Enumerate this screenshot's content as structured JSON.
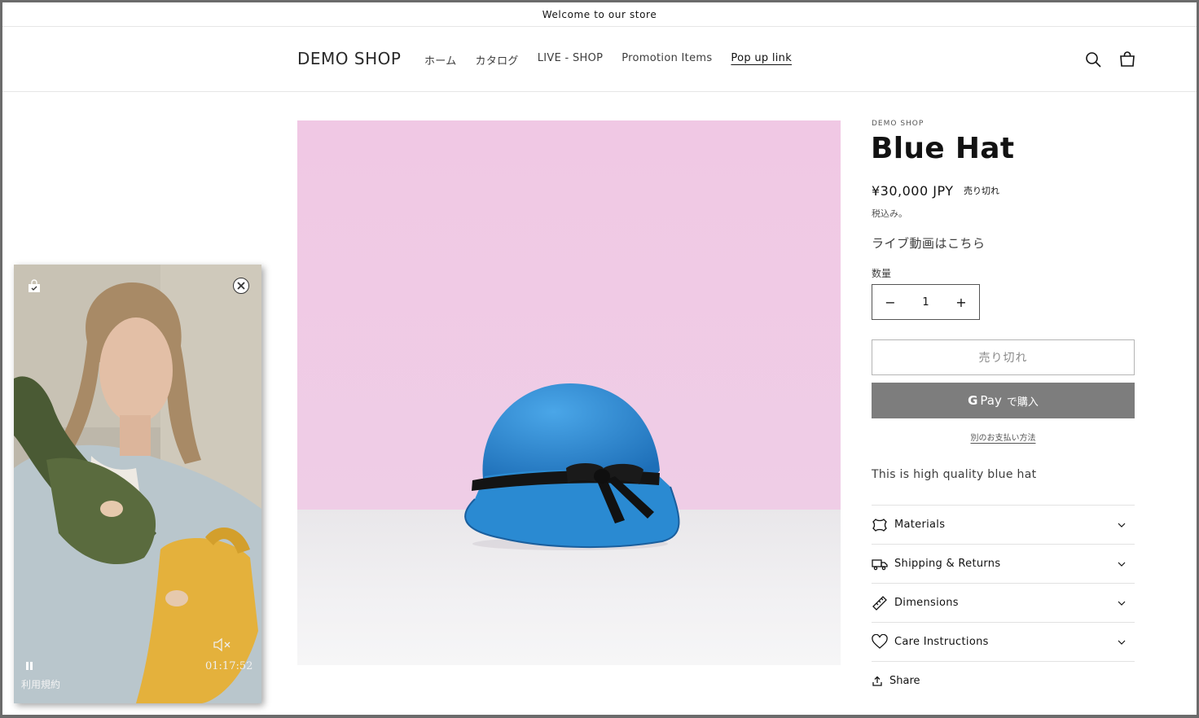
{
  "announcement": "Welcome to our store",
  "header": {
    "logo": "DEMO SHOP",
    "nav": [
      "ホーム",
      "カタログ",
      "LIVE - SHOP",
      "Promotion Items",
      "Pop up link"
    ],
    "search_icon": "search-icon",
    "cart_icon": "cart-icon"
  },
  "product": {
    "vendor": "DEMO SHOP",
    "title": "Blue Hat",
    "price": "¥30,000 JPY",
    "soldout_badge": "売り切れ",
    "tax_note": "税込み。",
    "live_text": "ライブ動画はこちら",
    "quantity_label": "数量",
    "quantity_value": "1",
    "minus": "−",
    "plus": "+",
    "soldout_button": "売り切れ",
    "gpay_g": "G",
    "gpay_pay": "Pay",
    "gpay_buy": "で購入",
    "more_payment": "別のお支払い方法",
    "description": "This is high quality blue hat",
    "accordions": [
      {
        "label": "Materials",
        "icon": "leather-icon"
      },
      {
        "label": "Shipping & Returns",
        "icon": "truck-icon"
      },
      {
        "label": "Dimensions",
        "icon": "ruler-icon"
      },
      {
        "label": "Care Instructions",
        "icon": "heart-icon"
      }
    ],
    "share": "Share"
  },
  "popup": {
    "time": "01:17:52",
    "terms": "利用規約",
    "icons": [
      "shopping-bag-icon",
      "close-icon",
      "mute-icon",
      "pause-icon"
    ]
  },
  "colors": {
    "hero_background": "#f0c8e4",
    "hat": "#2f8fd6",
    "gpay_button": "#7d7d7d"
  }
}
